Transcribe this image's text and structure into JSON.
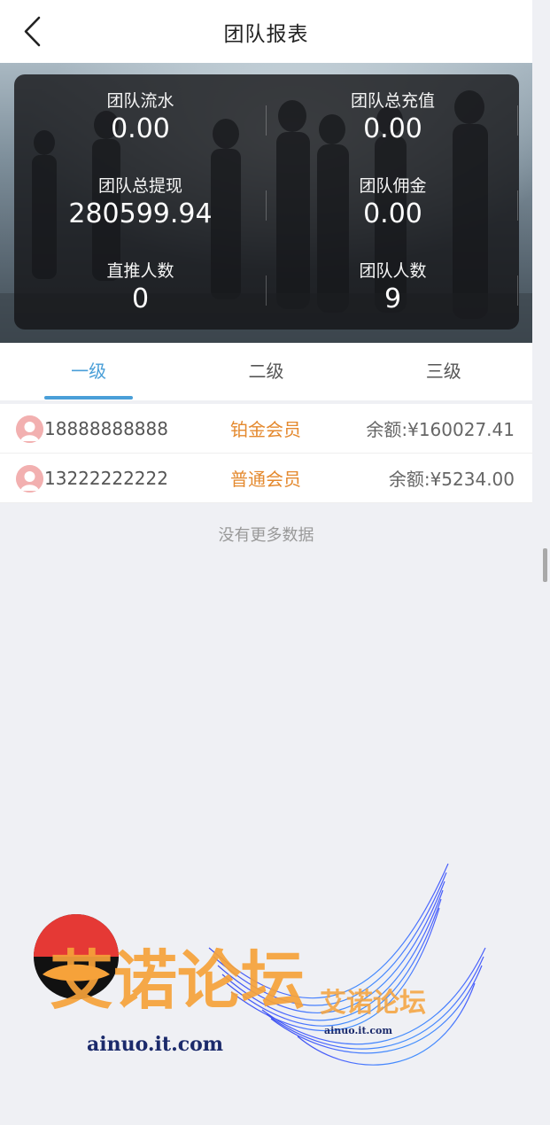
{
  "header": {
    "title": "团队报表"
  },
  "stats": {
    "team_flow": {
      "label": "团队流水",
      "value": "0.00"
    },
    "team_recharge": {
      "label": "团队总充值",
      "value": "0.00"
    },
    "team_withdraw": {
      "label": "团队总提现",
      "value": "280599.94"
    },
    "team_commission": {
      "label": "团队佣金",
      "value": "0.00"
    },
    "direct_count": {
      "label": "直推人数",
      "value": "0"
    },
    "team_count": {
      "label": "团队人数",
      "value": "9"
    }
  },
  "tabs": [
    {
      "label": "一级",
      "active": true
    },
    {
      "label": "二级",
      "active": false
    },
    {
      "label": "三级",
      "active": false
    }
  ],
  "members": [
    {
      "phone": "18888888888",
      "level": "铂金会员",
      "balance": "余额:¥160027.41"
    },
    {
      "phone": "13222222222",
      "level": "普通会员",
      "balance": "余额:¥5234.00"
    }
  ],
  "no_more_text": "没有更多数据",
  "watermark": {
    "title": "艾诺论坛",
    "small_title": "艾诺论坛",
    "url": "ainuo.it.com",
    "small_url": "ainuo.it.com"
  },
  "colors": {
    "accent": "#4a9fd8",
    "level_color": "#e4892e",
    "background": "#eff0f4"
  }
}
